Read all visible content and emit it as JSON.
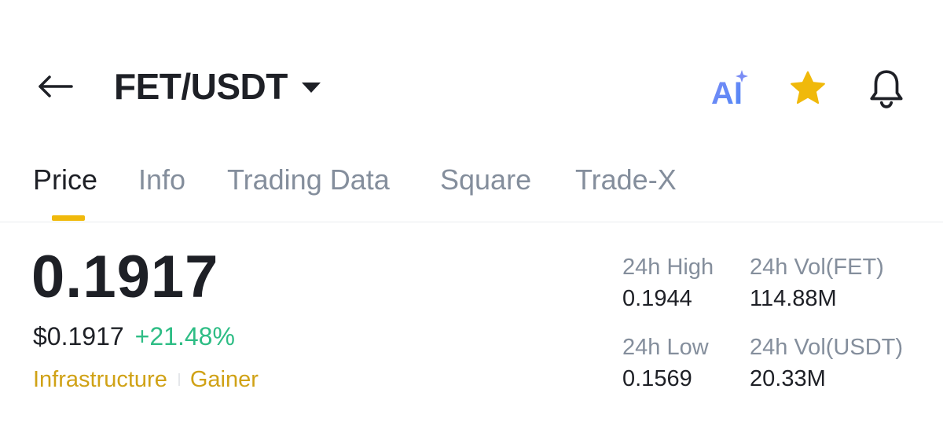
{
  "header": {
    "pair": "FET/USDT",
    "icons": [
      "back-arrow-icon",
      "caret-down-icon",
      "ai-icon",
      "star-icon",
      "bell-icon"
    ],
    "ai_label": "AI",
    "favorite": true,
    "star_color": "#F0B90B"
  },
  "tabs": [
    {
      "label": "Price",
      "active": true
    },
    {
      "label": "Info",
      "active": false
    },
    {
      "label": "Trading Data",
      "active": false
    },
    {
      "label": "Square",
      "active": false
    },
    {
      "label": "Trade-X",
      "active": false
    }
  ],
  "price": {
    "last": "0.1917",
    "usd": "$0.1917",
    "change": "+21.48%",
    "change_color": "#2EBD85"
  },
  "tags": [
    "Infrastructure",
    "Gainer"
  ],
  "stats": {
    "high_label": "24h High",
    "high_value": "0.1944",
    "vol_base_label": "24h Vol(FET)",
    "vol_base_value": "114.88M",
    "low_label": "24h Low",
    "low_value": "0.1569",
    "vol_quote_label": "24h Vol(USDT)",
    "vol_quote_value": "20.33M"
  },
  "colors": {
    "accent": "#F0B90B",
    "text_primary": "#1E2026",
    "text_secondary": "#848E9C",
    "tag": "#D0A216"
  }
}
